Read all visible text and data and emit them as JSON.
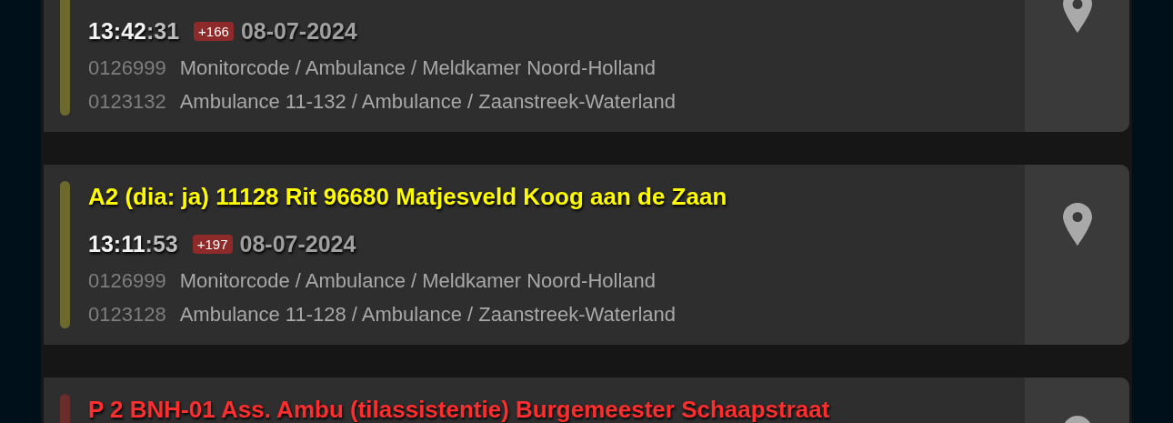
{
  "alerts": [
    {
      "time": "13:42:31",
      "badge": "+166",
      "date": "08-07-2024",
      "lines": [
        {
          "code": "0126999",
          "text": "Monitorcode / Ambulance / Meldkamer Noord-Holland"
        },
        {
          "code": "0123132",
          "text": "Ambulance 11-132 / Ambulance / Zaanstreek-Waterland"
        }
      ],
      "color": "#6b6a2c"
    },
    {
      "title": "A2 (dia: ja) 11128 Rit 96680 Matjesveld Koog aan de Zaan",
      "time": "13:11:53",
      "badge": "+197",
      "date": "08-07-2024",
      "lines": [
        {
          "code": "0126999",
          "text": "Monitorcode / Ambulance / Meldkamer Noord-Holland"
        },
        {
          "code": "0123128",
          "text": "Ambulance 11-128 / Ambulance / Zaanstreek-Waterland"
        }
      ],
      "color": "#6b6a2c"
    },
    {
      "title": "P 2 BNH-01 Ass. Ambu (tilassistentie) Burgemeester Schaapstraat",
      "color": "#6b2c2c"
    }
  ]
}
